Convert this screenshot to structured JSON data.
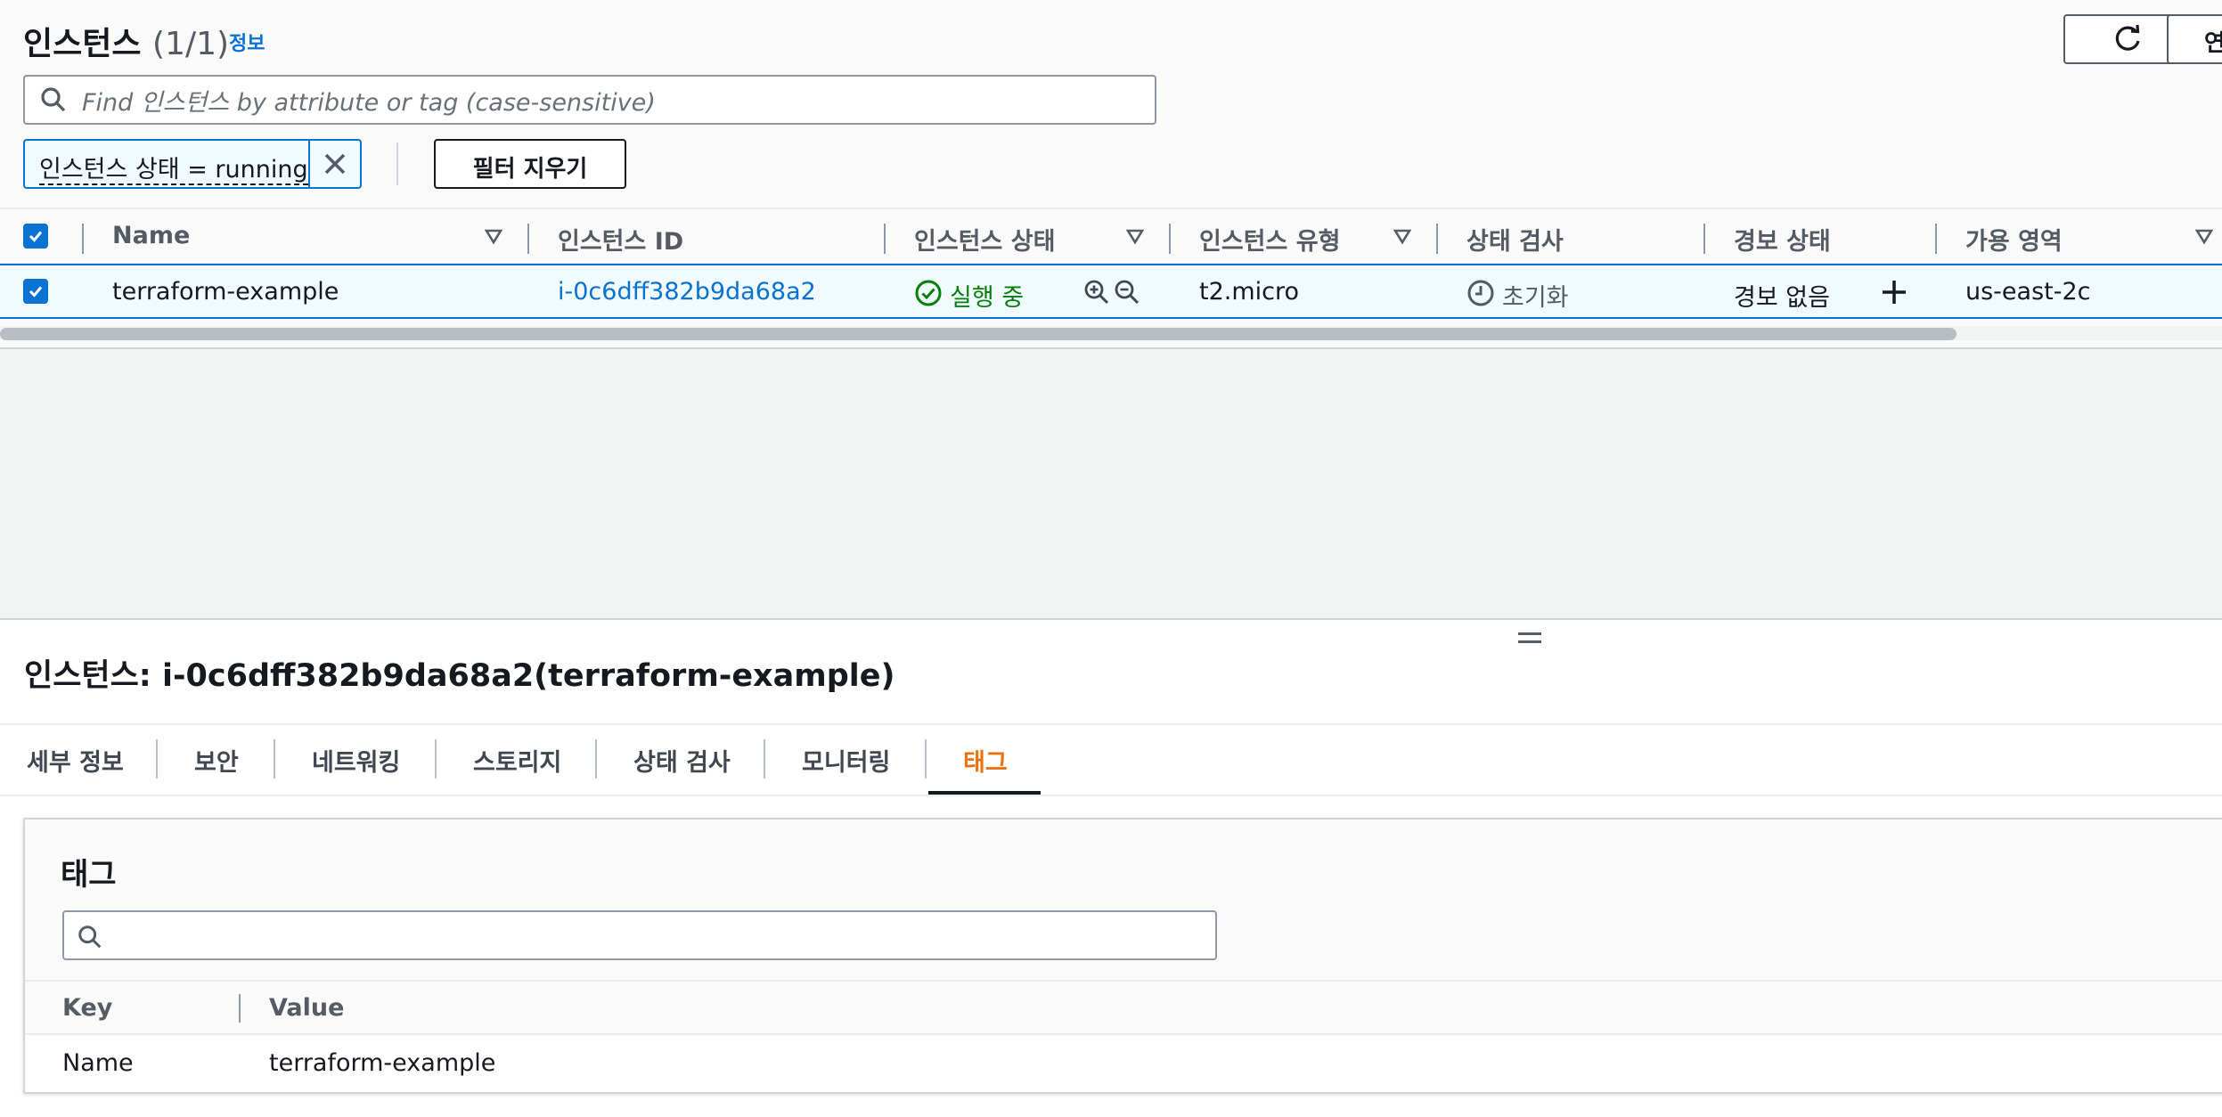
{
  "header": {
    "title": "인스턴스",
    "count": "(1/1)",
    "info_link": "정보",
    "right_button_label": "연"
  },
  "search": {
    "placeholder": "Find 인스턴스 by attribute or tag (case-sensitive)"
  },
  "filter": {
    "token_label": "인스턴스 상태 = running",
    "clear_button": "필터 지우기"
  },
  "table": {
    "columns": [
      "Name",
      "인스턴스 ID",
      "인스턴스 상태",
      "인스턴스 유형",
      "상태 검사",
      "경보 상태",
      "가용 영역"
    ],
    "rows": [
      {
        "name": "terraform-example",
        "instance_id": "i-0c6dff382b9da68a2",
        "state": "실행 중",
        "type": "t2.micro",
        "status_check": "초기화",
        "alarm_status": "경보 없음",
        "az": "us-east-2c"
      }
    ]
  },
  "details": {
    "title": "인스턴스: i-0c6dff382b9da68a2(terraform-example)",
    "tabs": [
      "세부 정보",
      "보안",
      "네트워킹",
      "스토리지",
      "상태 검사",
      "모니터링",
      "태그"
    ],
    "active_tab": "태그"
  },
  "tags_panel": {
    "title": "태그",
    "search_placeholder": "",
    "columns": [
      "Key",
      "Value"
    ],
    "rows": [
      {
        "key": "Name",
        "value": "terraform-example"
      }
    ]
  },
  "colors": {
    "accent": "#0972d3",
    "running": "#037f0c",
    "active_tab": "#ec7211"
  },
  "icons": [
    "refresh-icon",
    "search-icon",
    "close-icon",
    "sort-down-icon",
    "check-circle-icon",
    "zoom-in-icon",
    "zoom-out-icon",
    "clock-icon",
    "plus-icon",
    "drag-handle-icon"
  ]
}
